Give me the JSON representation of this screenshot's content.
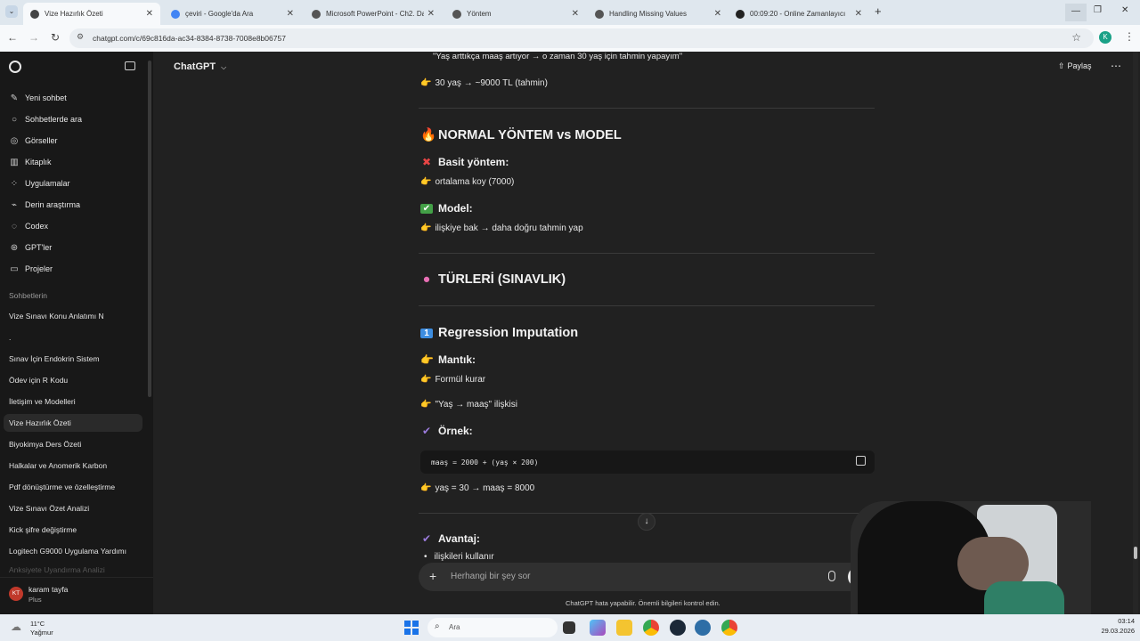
{
  "browser": {
    "tabs": [
      {
        "title": "Vize Hazırlık Özeti",
        "active": true,
        "favicon_color": "#444444"
      },
      {
        "title": "çeviri - Google'da Ara",
        "active": false,
        "favicon_color": "#4285F4"
      },
      {
        "title": "Microsoft PowerPoint - Ch2. Da",
        "active": false,
        "favicon_color": "#555555"
      },
      {
        "title": "Yöntem",
        "active": false,
        "favicon_color": "#555555"
      },
      {
        "title": "Handling Missing Values",
        "active": false,
        "favicon_color": "#555555"
      },
      {
        "title": "00:09:20 - Online Zamanlayıcı",
        "active": false,
        "favicon_color": "#222222"
      }
    ],
    "url": "chatgpt.com/c/69c816da-ac34-8384-8738-7008e8b06757",
    "profile_initial": "K"
  },
  "sidebar": {
    "nav": [
      {
        "label": "Yeni sohbet",
        "icon": "edit-icon"
      },
      {
        "label": "Sohbetlerde ara",
        "icon": "search-icon"
      },
      {
        "label": "Görseller",
        "icon": "images-icon"
      },
      {
        "label": "Kitaplık",
        "icon": "library-icon"
      },
      {
        "label": "Uygulamalar",
        "icon": "apps-icon"
      },
      {
        "label": "Derin araştırma",
        "icon": "research-icon"
      },
      {
        "label": "Codex",
        "icon": "codex-icon"
      },
      {
        "label": "GPT'ler",
        "icon": "gpts-icon"
      },
      {
        "label": "Projeler",
        "icon": "folder-icon"
      }
    ],
    "section_label": "Sohbetlerin",
    "chats": [
      "Vize Sınavı Konu Anlatımı N",
      ".",
      "Sınav İçin Endokrin Sistem",
      "Ödev için R Kodu",
      "İletişim ve Modelleri",
      "Vize Hazırlık Özeti",
      "Biyokimya Ders Özeti",
      "Halkalar ve Anomerik Karbon",
      "Pdf dönüştürme ve özelleştirme",
      "Vize Sınavı Özet Analizi",
      "Kick şifre değiştirme",
      "Logitech G9000 Uygulama Yardımı",
      "Anksiyete Uyandırma Analizi"
    ],
    "active_chat_index": 5,
    "user": {
      "initials": "KT",
      "name": "karam tayfa",
      "plan": "Plus"
    }
  },
  "header": {
    "model": "ChatGPT",
    "share": "Paylaş"
  },
  "content": {
    "quote": "\"Yaş arttıkça maaş artıyor → o zaman 30 yaş için tahmin yapayım\"",
    "estimate": "30 yaş → ~9000 TL (tahmin)",
    "section1_title": "NORMAL YÖNTEM vs MODEL",
    "simple_title": "Basit yöntem:",
    "simple_text": "ortalama koy (7000)",
    "model_title": "Model:",
    "model_text": "ilişkiye bak → daha doğru tahmin yap",
    "section2_title": "TÜRLERİ (SINAVLIK)",
    "section3_title": "Regression Imputation",
    "logic_title": "Mantık:",
    "logic_item1": "Formül kurar",
    "logic_item2": "\"Yaş → maaş\" ilişkisi",
    "example_title": "Örnek:",
    "code": "maaş = 2000 + (yaş × 200)",
    "result": "yaş = 30 → maaş = 8000",
    "advantage_title": "Avantaj:",
    "advantage_item1": "ilişkileri kullanır"
  },
  "composer": {
    "placeholder": "Herhangi bir şey sor",
    "disclaimer": "ChatGPT hata yapabilir. Önemli bilgileri kontrol edin."
  },
  "taskbar": {
    "weather_temp": "11°C",
    "weather_desc": "Yağmur",
    "search_label": "Ara",
    "time": "03:14",
    "date": "29.03.2026"
  }
}
